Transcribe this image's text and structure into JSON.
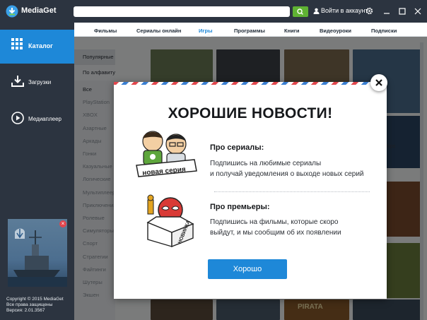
{
  "app": {
    "title": "MediaGet",
    "search_placeholder": "",
    "login_label": "Войти в аккаунт"
  },
  "sidebar": {
    "items": [
      {
        "label": "Каталог",
        "icon": "grid-icon"
      },
      {
        "label": "Загрузки",
        "icon": "download-icon"
      },
      {
        "label": "Медиаплеер",
        "icon": "play-icon"
      }
    ],
    "copyright": [
      "Copyright © 2015 MediaGet",
      "Все права защищены",
      "Версия: 2.01.3567"
    ]
  },
  "tabs": [
    "Фильмы",
    "Сериалы онлайн",
    "Игры",
    "Программы",
    "Книги",
    "Видеоуроки",
    "Подписки"
  ],
  "active_tab": "Игры",
  "filters": {
    "sort": [
      "Популярные",
      "По алфавиту"
    ],
    "genres": [
      "Все",
      "PlayStation",
      "XBOX",
      "Азартные",
      "Аркады",
      "Гонки",
      "Казуальные",
      "Логические",
      "Мультиплеер",
      "Приключения",
      "Ролевые",
      "Симуляторы",
      "Спорт",
      "Стратегии",
      "Файтинги",
      "Шутеры",
      "Экшен"
    ]
  },
  "background_labels": [
    "ships",
    "PIRATA"
  ],
  "modal": {
    "title": "ХОРОШИЕ НОВОСТИ!",
    "features": [
      {
        "title": "Про сериалы:",
        "lines": [
          "Подпишись на любимые сериалы",
          "и получай уведомления о выходе новых серий"
        ],
        "badge": "новая серия"
      },
      {
        "title": "Про премьеры:",
        "lines": [
          "Подпишись на фильмы, которые скоро",
          "выйдут, и мы сообщим об их появлении"
        ],
        "badge": "НОВИНКА"
      }
    ],
    "ok_label": "Хорошо"
  },
  "colors": {
    "accent": "#1e88d8",
    "dark": "#2c3440",
    "search_button": "#5fb233",
    "close_badge": "#e2454d"
  }
}
